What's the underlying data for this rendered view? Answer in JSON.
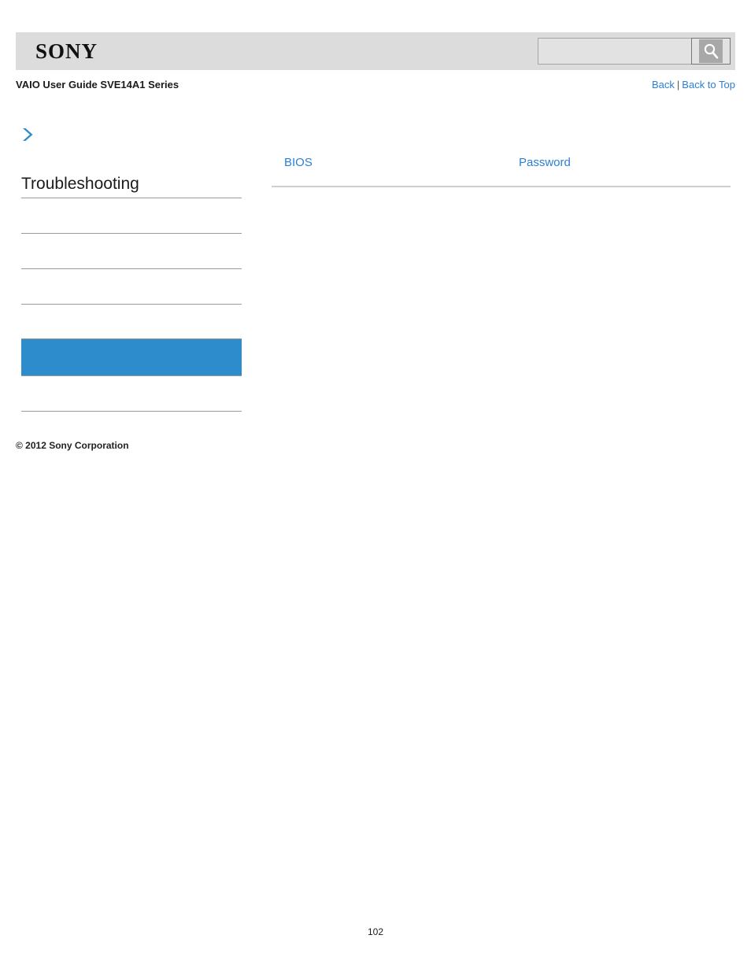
{
  "header": {
    "logo_text": "SONY",
    "search": {
      "value": "",
      "placeholder": "",
      "button_icon": "search-icon"
    }
  },
  "subheader": {
    "guide_title": "VAIO User Guide SVE14A1 Series",
    "back_label": "Back",
    "separator": "|",
    "back_to_top_label": "Back to Top"
  },
  "sidebar": {
    "breadcrumb_icon": "chevron-right-icon",
    "title": "Troubleshooting",
    "items": [
      {
        "label": "",
        "selected": false
      },
      {
        "label": "",
        "selected": false
      },
      {
        "label": "",
        "selected": false
      },
      {
        "label": "",
        "selected": false
      },
      {
        "label": "",
        "selected": true
      },
      {
        "label": "",
        "selected": false
      }
    ]
  },
  "main": {
    "links": [
      {
        "label": "BIOS",
        "column": 1
      },
      {
        "label": "Password",
        "column": 2
      }
    ]
  },
  "footer": {
    "copyright": "© 2012 Sony Corporation",
    "page_number": "102"
  },
  "colors": {
    "header_bar": "#dcdcdc",
    "link_blue": "#2b7fd4",
    "selected_blue": "#2d8ccb",
    "divider_gray": "#9a9a9a",
    "rule_gray": "#cfcfcf"
  }
}
